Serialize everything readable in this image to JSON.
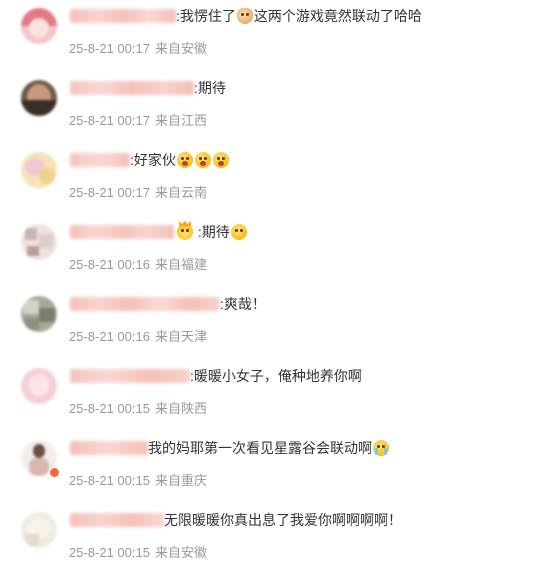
{
  "comments": [
    {
      "text_parts": [
        ":我愣住了",
        "这两个游戏竟然联动了哈哈"
      ],
      "emojis": [
        "dog-face-emoji"
      ],
      "time": "25-8-21 00:17",
      "location": "来自安徽"
    },
    {
      "text_parts": [
        ":期待"
      ],
      "emojis": [],
      "time": "25-8-21 00:17",
      "location": "来自江西"
    },
    {
      "text_parts": [
        ":好家伙"
      ],
      "emojis": [
        "shocked-face-emoji",
        "shocked-face-emoji",
        "shocked-face-emoji"
      ],
      "time": "25-8-21 00:17",
      "location": "来自云南"
    },
    {
      "text_parts": [
        " :期待"
      ],
      "emojis": [
        "crown-emoji",
        "hug-face-emoji"
      ],
      "time": "25-8-21 00:16",
      "location": "来自福建"
    },
    {
      "text_parts": ":爽哉！",
      "time": "25-8-21 00:16",
      "location": "来自天津"
    },
    {
      "text_parts": ":暖暖小女子，俺种地养你啊",
      "time": "25-8-21 00:15",
      "location": "来自陕西"
    },
    {
      "text_parts": [
        "我的妈耶第一次看见星露谷会联动啊"
      ],
      "emojis": [
        "crying-face-emoji"
      ],
      "time": "25-8-21 00:15",
      "location": "来自重庆"
    },
    {
      "text_parts": "无限暖暖你真出息了我爱你啊啊啊啊！",
      "time": "25-8-21 00:15",
      "location": "来自安徽"
    }
  ],
  "colors": {
    "text": "#333333",
    "meta": "#999999",
    "name_blur": "#f4b3aa",
    "background": "#ffffff"
  }
}
